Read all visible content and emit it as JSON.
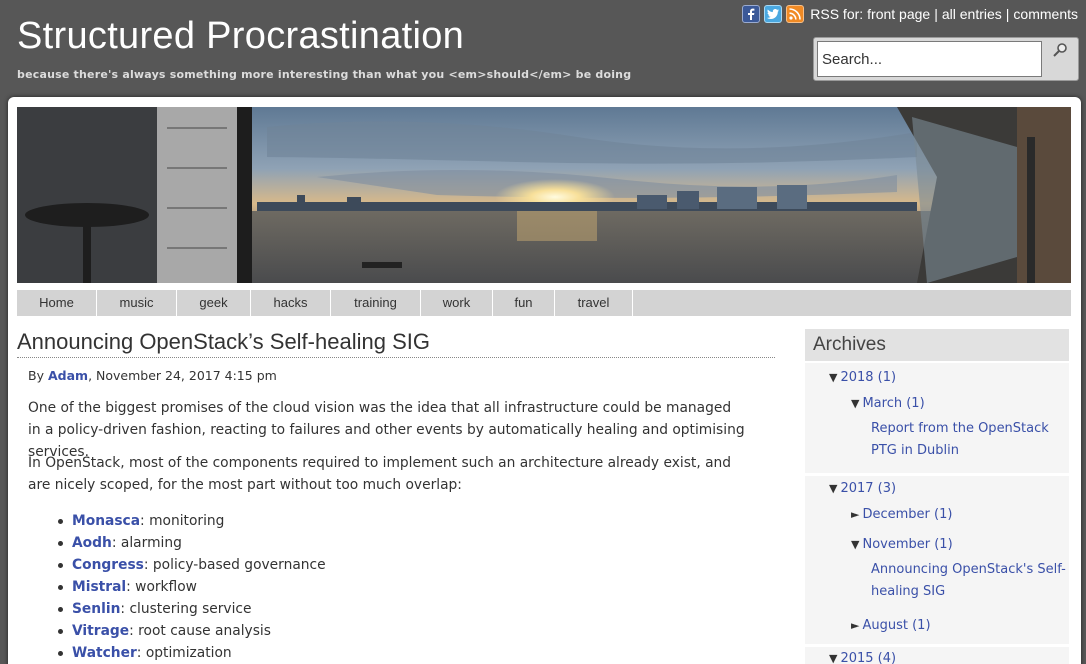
{
  "site": {
    "title": "Structured Procrastination",
    "tagline": "because there's always something more interesting than what you <em>should</em> be doing"
  },
  "rss": {
    "prefix": "RSS for:",
    "front_page": "front page",
    "all_entries": "all entries",
    "comments": "comments",
    "sep": "|"
  },
  "search": {
    "placeholder": "Search...",
    "value": "Search..."
  },
  "nav": {
    "items": [
      "Home",
      "music",
      "geek",
      "hacks",
      "training",
      "work",
      "fun",
      "travel"
    ]
  },
  "post": {
    "title": "Announcing OpenStack’s Self-healing SIG",
    "by": "By",
    "author": "Adam",
    "date": ", November 24, 2017 4:15 pm",
    "para1": "One of the biggest promises of the cloud vision was the idea that all infrastructure could be managed in a policy-driven fashion, reacting to failures and other events by automatically healing and optimising services.",
    "para2": "In OpenStack, most of the components required to implement such an architecture already exist, and are nicely scoped, for the most part without too much overlap:",
    "tools": [
      {
        "name": "Monasca",
        "desc": ": monitoring"
      },
      {
        "name": "Aodh",
        "desc": ": alarming"
      },
      {
        "name": "Congress",
        "desc": ": policy-based governance"
      },
      {
        "name": "Mistral",
        "desc": ": workflow"
      },
      {
        "name": "Senlin",
        "desc": ": clustering service"
      },
      {
        "name": "Vitrage",
        "desc": ": root cause analysis"
      },
      {
        "name": "Watcher",
        "desc": ": optimization"
      }
    ]
  },
  "sidebar": {
    "heading": "Archives",
    "y2018": "2018 (1)",
    "march": "March (1)",
    "march_post": "Report from the OpenStack PTG in Dublin",
    "y2017": "2017 (3)",
    "december": "December (1)",
    "november": "November (1)",
    "november_post": "Announcing OpenStack's Self-healing SIG",
    "august": "August (1)",
    "y2015": "2015 (4)",
    "arrow_open": "▼",
    "arrow_closed": "►"
  }
}
